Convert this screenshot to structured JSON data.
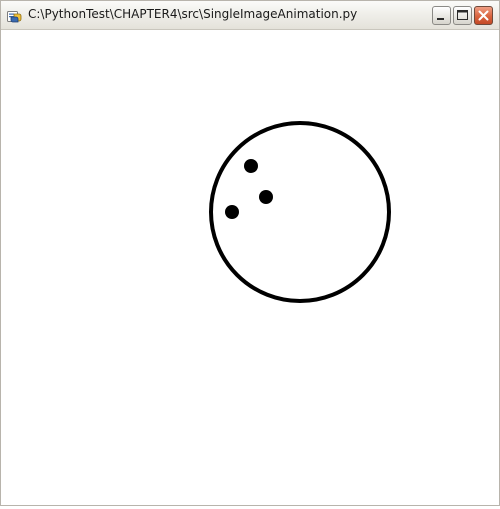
{
  "window": {
    "title": "C:\\PythonTest\\CHAPTER4\\src\\SingleImageAnimation.py",
    "icon": "python-file-icon",
    "controls": {
      "minimize_icon": "minimize-icon",
      "maximize_icon": "maximize-icon",
      "close_icon": "close-icon"
    }
  },
  "canvas": {
    "background": "#ffffff",
    "image": "bowling-ball-icon",
    "stroke_color": "#000000"
  }
}
